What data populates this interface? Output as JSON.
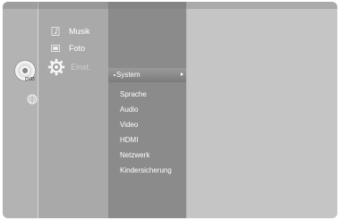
{
  "main_menu": {
    "items": [
      {
        "label": "Musik",
        "icon": "music-note-icon"
      },
      {
        "label": "Foto",
        "icon": "photo-icon"
      },
      {
        "label": "Einst.",
        "icon": "gear-icon"
      }
    ]
  },
  "source": {
    "disc_label": "DVD",
    "disc_icon": "dvd-disc-icon",
    "network_icon": "globe-icon"
  },
  "submenu": {
    "selected": "System",
    "items": [
      "System",
      "Sprache",
      "Audio",
      "Video",
      "HDMI",
      "Netzwerk",
      "Kindersicherung"
    ]
  },
  "colors": {
    "panel": "#c9c9c9",
    "highlight": "#8b8b8b",
    "text": "#ffffff"
  }
}
